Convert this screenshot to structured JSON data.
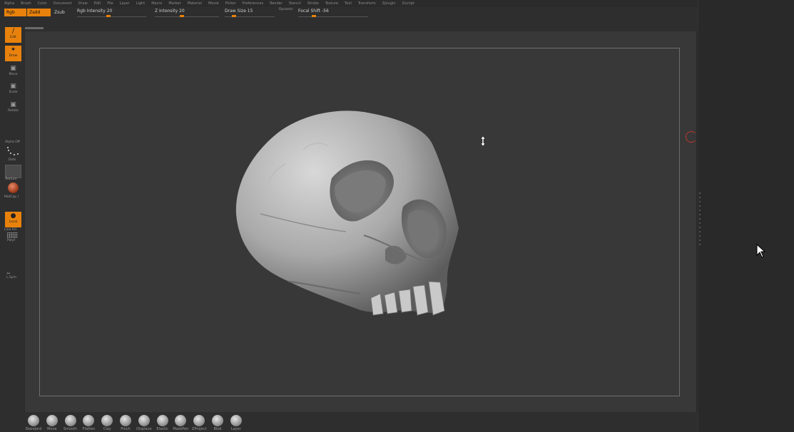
{
  "menu": [
    "Alpha",
    "Brush",
    "Color",
    "Document",
    "Draw",
    "Edit",
    "File",
    "Layer",
    "Light",
    "Macro",
    "Marker",
    "Material",
    "Movie",
    "Picker",
    "Preferences",
    "Render",
    "Stencil",
    "Stroke",
    "Texture",
    "Tool",
    "Transform",
    "Zplugin",
    "Zscript"
  ],
  "toolbar": {
    "rgb_label": "Rgb",
    "zadd_label": "Zadd",
    "zsub_label": "Zsub",
    "rgb_intensity_label": "Rgb Intensity 20",
    "z_intensity_label": "Z Intensity 20",
    "draw_size_label": "Draw Size 15",
    "dynamic_label": "Dynamic",
    "focal_shift_label": "Focal Shift -56",
    "rgb_intensity": 20,
    "z_intensity": 20,
    "draw_size": 15,
    "focal_shift": -56
  },
  "leftpanel": {
    "edit_label": "Edit",
    "draw_label": "Draw",
    "move_label": "Move",
    "scale_label": "Scale",
    "rotate_label": "Rotate",
    "alpha_label": "Alpha Off",
    "dots_label": "Dots",
    "texture_label": "Texture",
    "matcap_label": "MatCap I",
    "local_label": "Local",
    "linefill_label": "Line Fill",
    "polyf_label": "PolyF",
    "lsym_label": "L.Sym"
  },
  "brushes": [
    "Standard",
    "Move",
    "Smooth",
    "Flatten",
    "Clay",
    "Pinch",
    "Displace",
    "Elastic",
    "MaskPen",
    "ZProject",
    "Blob",
    "Layer"
  ],
  "colors": {
    "accent": "#e8820c",
    "viewport": "#383838",
    "marker": "#c0392b"
  },
  "icons": {
    "cursor": "arrow-cursor-icon",
    "resize": "vertical-resize-icon",
    "model": "skull-model"
  }
}
